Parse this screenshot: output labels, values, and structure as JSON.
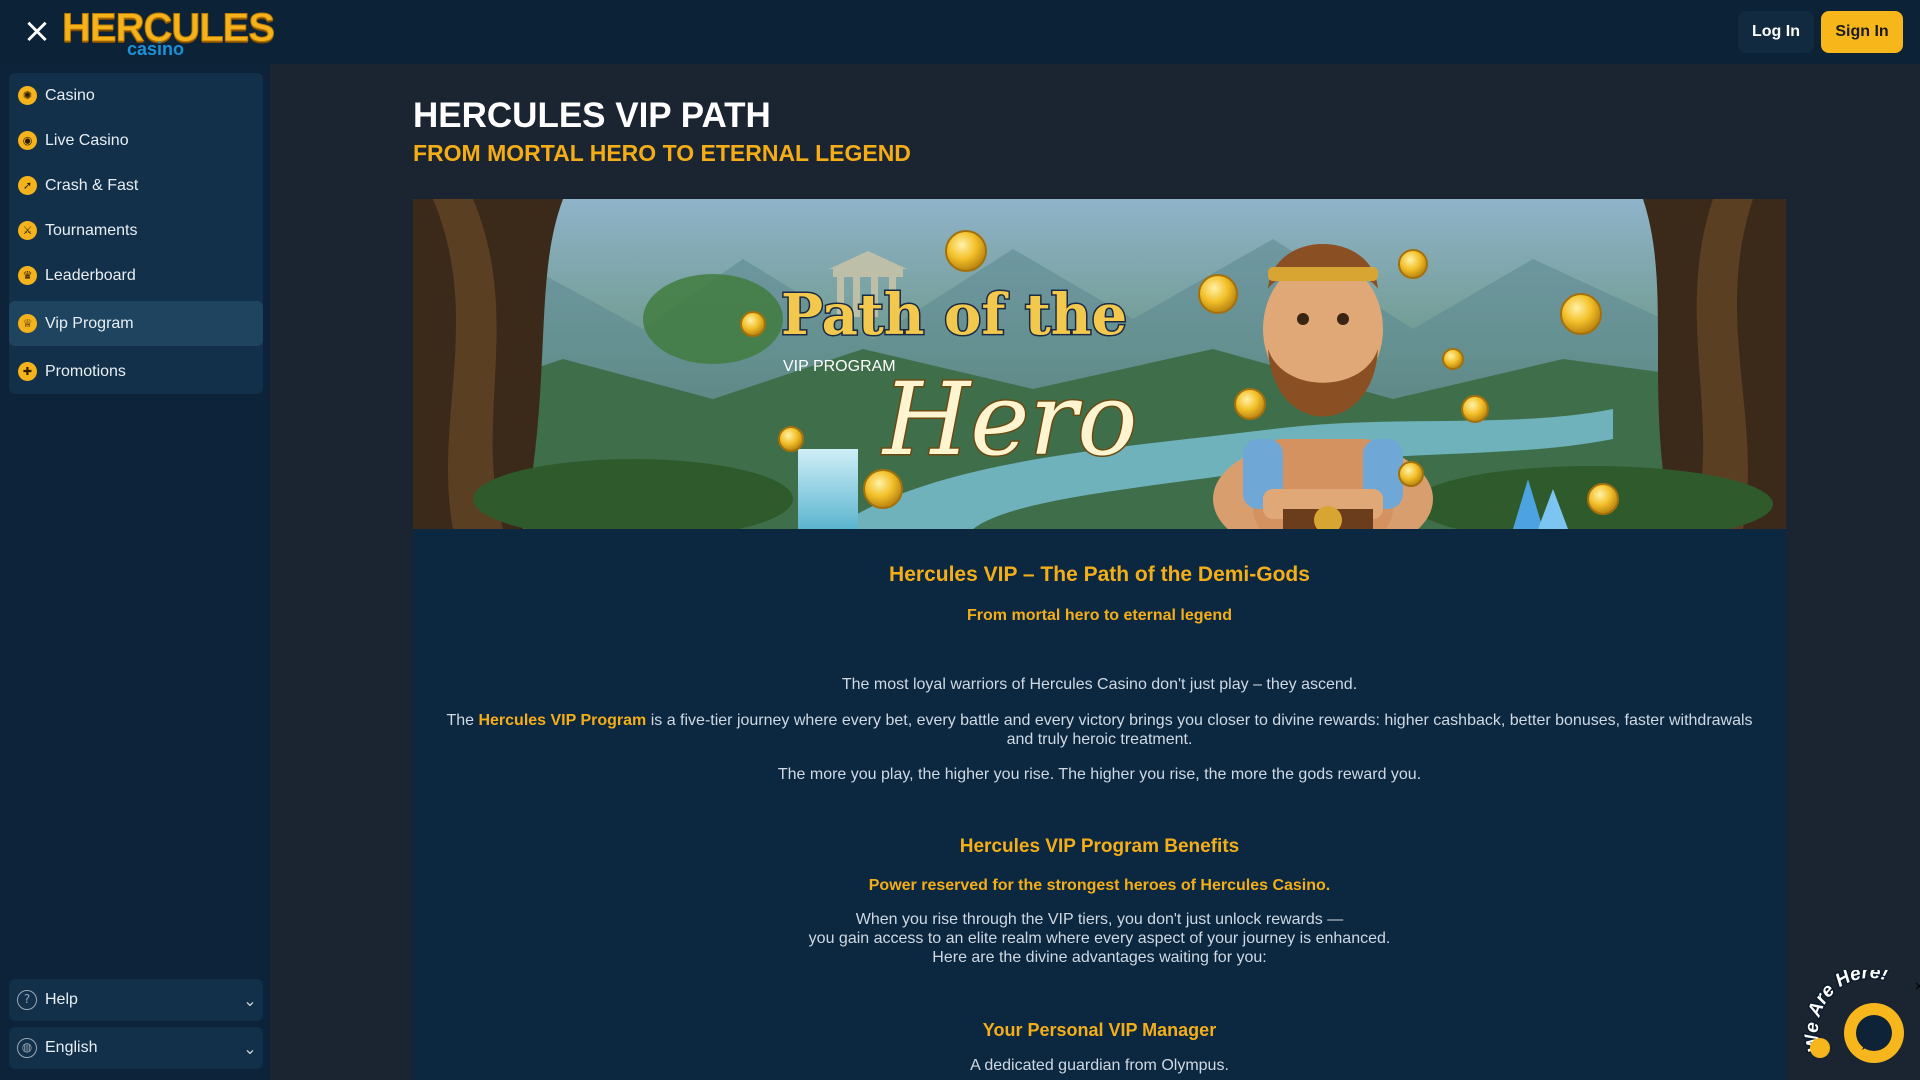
{
  "header": {
    "logo_main": "HERCULES",
    "logo_sub": "casino",
    "login_label": "Log In",
    "signin_label": "Sign In"
  },
  "sidebar": {
    "items": [
      {
        "label": "Casino",
        "icon": "casino-chip-icon"
      },
      {
        "label": "Live Casino",
        "icon": "live-casino-icon"
      },
      {
        "label": "Crash & Fast",
        "icon": "rocket-icon"
      },
      {
        "label": "Tournaments",
        "icon": "tournament-icon"
      },
      {
        "label": "Leaderboard",
        "icon": "trophy-icon"
      },
      {
        "label": "Vip Program",
        "icon": "crown-icon",
        "active": true
      },
      {
        "label": "Promotions",
        "icon": "gift-icon"
      }
    ],
    "help_label": "Help",
    "language_label": "English"
  },
  "page": {
    "title": "HERCULES VIP PATH",
    "subtitle": "FROM MORTAL HERO TO ETERNAL LEGEND"
  },
  "banner": {
    "headline_top": "Path of the",
    "headline_script": "Hero",
    "tag": "VIP PROGRAM"
  },
  "content": {
    "section1_title": "Hercules VIP – The Path of the Demi-Gods",
    "section1_sub": "From mortal hero to eternal legend",
    "p1": "The most loyal warriors of Hercules Casino don't just play – they ascend.",
    "p2_pre": "The ",
    "p2_bold": "Hercules VIP Program",
    "p2_post": " is a five-tier journey where every bet, every battle and every victory brings you closer to divine rewards: higher cashback, better bonuses, faster withdrawals and truly heroic treatment.",
    "p3": "The more you play, the higher you rise. The higher you rise, the more the gods reward you.",
    "section2_title": "Hercules VIP Program Benefits",
    "section2_sub": "Power reserved for the strongest heroes of Hercules Casino.",
    "p4_line1": "When you rise through the VIP tiers, you don't just unlock rewards —",
    "p4_line2": "you gain access to an elite realm where every aspect of your journey is enhanced.",
    "p4_line3": "Here are the divine advantages waiting for you:",
    "section3_title": "Your Personal VIP Manager",
    "p5": "A dedicated guardian from Olympus."
  },
  "chat": {
    "badge_text": "We Are Here!"
  },
  "colors": {
    "accent": "#f5ad17",
    "topbar": "#0c2237",
    "sidebar": "#0d2339",
    "content_bg": "#0c2740",
    "page_bg": "#1b2531"
  }
}
